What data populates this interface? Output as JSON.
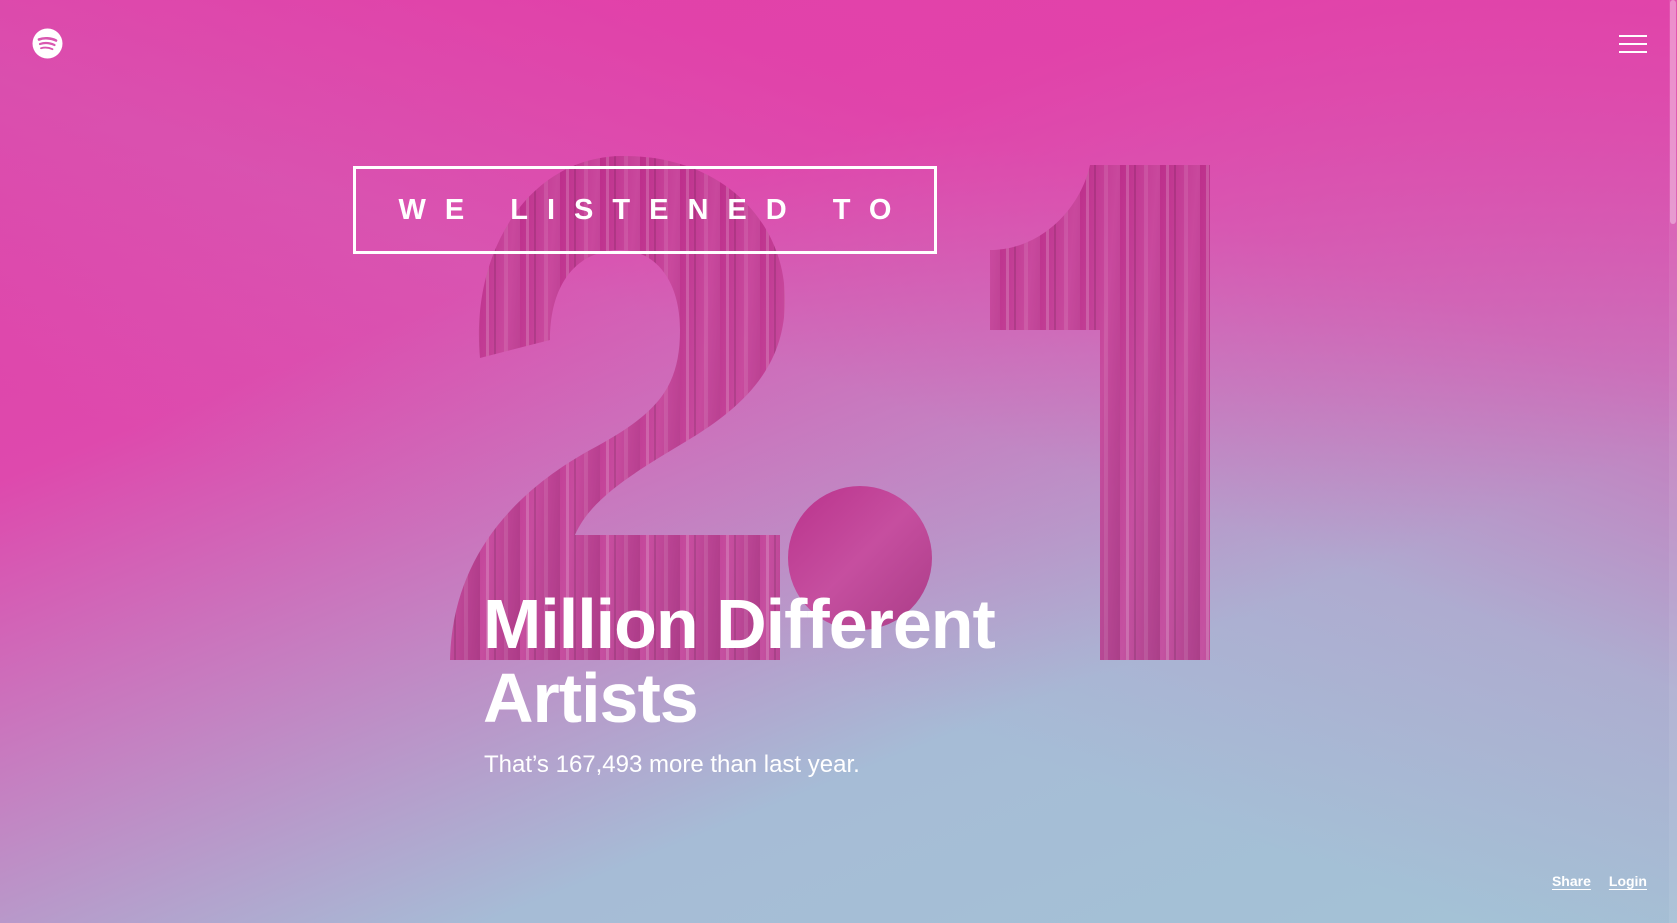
{
  "header": {
    "logo_icon": "spotify-logo-icon",
    "menu_icon": "hamburger-menu-icon"
  },
  "hero": {
    "kicker": "WE LISTENED TO",
    "big_number": "2.1",
    "title": "Million Different Artists",
    "subtitle": "That’s 167,493 more than last year."
  },
  "footer": {
    "share_label": "Share",
    "login_label": "Login"
  },
  "colors": {
    "gradient_pink": "#e13fa8",
    "gradient_blue": "#a3c3d6",
    "number_fill": "#c2338f"
  }
}
